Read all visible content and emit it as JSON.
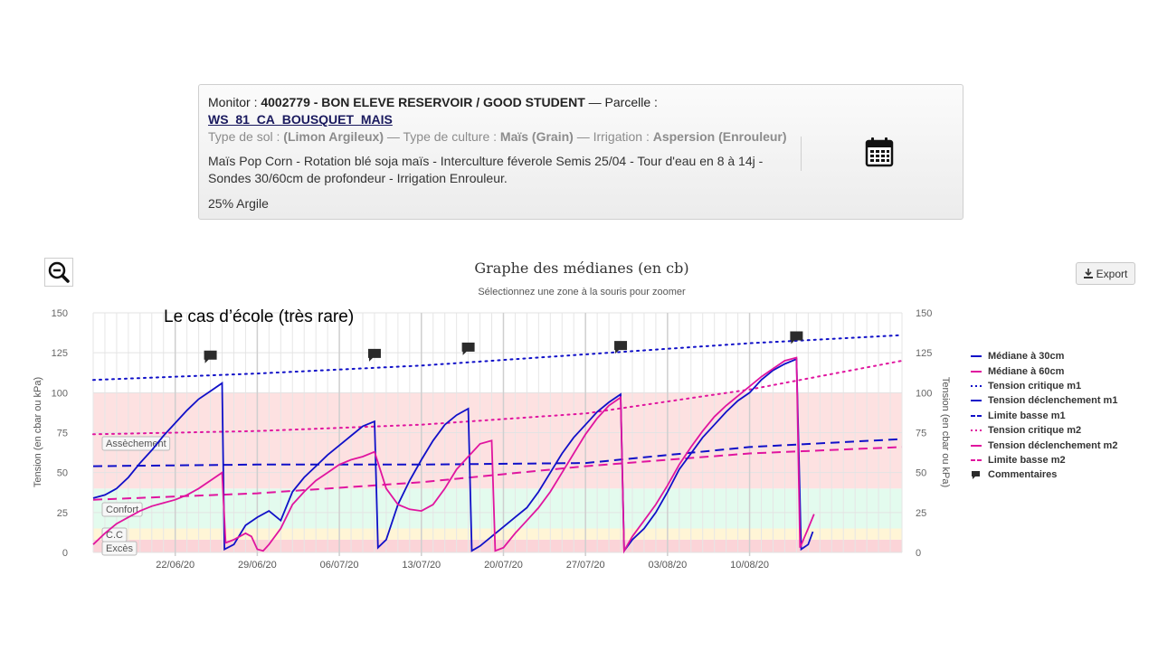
{
  "monitor": {
    "label": "Monitor :",
    "name": "4002779 - BON ELEVE RESERVOIR / GOOD STUDENT",
    "dash": "—",
    "parcelle_label": "Parcelle :",
    "parcelle": "WS_81_CA_BOUSQUET_MAIS",
    "soil_label": "Type de sol :",
    "soil": "(Limon Argileux)",
    "culture_label": "— Type de culture :",
    "culture": "Maïs (Grain)",
    "irrigation_label": "— Irrigation :",
    "irrigation": "Aspersion (Enrouleur)",
    "description": "Maïs Pop Corn - Rotation blé soja maïs - Interculture féverole Semis 25/04 - Tour d'eau en 8 à 14j - Sondes 30/60cm de profondeur - Irrigation Enrouleur.",
    "clay": "25% Argile"
  },
  "toolbar": {
    "export_label": "Export",
    "zoom_icon": "zoom-out-icon",
    "calendar_icon": "calendar-icon",
    "export_icon": "download-icon"
  },
  "annotation": "Le cas d’école (très rare)",
  "colors": {
    "m1": "#1010c8",
    "m2": "#e0159f",
    "assechement": "#fde1e1",
    "confort": "#e3fbee",
    "cc": "#fff5d6",
    "exces": "#fbd4d8"
  },
  "chart_data": {
    "type": "line",
    "title": "Graphe des médianes (en cb)",
    "subtitle": "Sélectionnez une zone à la souris pour zoomer",
    "ylabel": "Tension (en cbar ou kPa)",
    "ylabel_right": "Tension (en cbar ou kPa)",
    "ylim": [
      0,
      150
    ],
    "yticks": [
      0,
      25,
      50,
      75,
      100,
      125,
      150
    ],
    "xlim": [
      "2020-06-15",
      "2020-08-23"
    ],
    "xticks": [
      "22/06/20",
      "29/06/20",
      "06/07/20",
      "13/07/20",
      "20/07/20",
      "27/07/20",
      "03/08/20",
      "10/08/20"
    ],
    "grid": true,
    "legend_position": "right",
    "bands": [
      {
        "name": "Excès",
        "from": 0,
        "to": 8
      },
      {
        "name": "C.C",
        "from": 8,
        "to": 15
      },
      {
        "name": "Confort",
        "from": 15,
        "to": 40
      },
      {
        "name": "Assèchement",
        "from": 40,
        "to": 100
      }
    ],
    "series": [
      {
        "name": "Médiane à 30cm",
        "style": "solid",
        "group": "m1",
        "points": [
          [
            "2020-06-15",
            34
          ],
          [
            "2020-06-16",
            36
          ],
          [
            "2020-06-17",
            40
          ],
          [
            "2020-06-18",
            47
          ],
          [
            "2020-06-19",
            56
          ],
          [
            "2020-06-20",
            64
          ],
          [
            "2020-06-21",
            73
          ],
          [
            "2020-06-22",
            81
          ],
          [
            "2020-06-23",
            89
          ],
          [
            "2020-06-24",
            96
          ],
          [
            "2020-06-25",
            101
          ],
          [
            "2020-06-26",
            106
          ],
          [
            "2020-06-26.2",
            2
          ],
          [
            "2020-06-27",
            5
          ],
          [
            "2020-06-28",
            17
          ],
          [
            "2020-06-29",
            22
          ],
          [
            "2020-06-30",
            26
          ],
          [
            "2020-07-01",
            20
          ],
          [
            "2020-07-02",
            38
          ],
          [
            "2020-07-03",
            47
          ],
          [
            "2020-07-04",
            54
          ],
          [
            "2020-07-05",
            61
          ],
          [
            "2020-07-06",
            67
          ],
          [
            "2020-07-07",
            73
          ],
          [
            "2020-07-08",
            79
          ],
          [
            "2020-07-09",
            82
          ],
          [
            "2020-07-09.3",
            3
          ],
          [
            "2020-07-10",
            8
          ],
          [
            "2020-07-11",
            30
          ],
          [
            "2020-07-12",
            45
          ],
          [
            "2020-07-13",
            58
          ],
          [
            "2020-07-14",
            70
          ],
          [
            "2020-07-15",
            80
          ],
          [
            "2020-07-16",
            86
          ],
          [
            "2020-07-17",
            90
          ],
          [
            "2020-07-17.3",
            1
          ],
          [
            "2020-07-18",
            4
          ],
          [
            "2020-07-19",
            10
          ],
          [
            "2020-07-20",
            16
          ],
          [
            "2020-07-21",
            22
          ],
          [
            "2020-07-22",
            28
          ],
          [
            "2020-07-23",
            38
          ],
          [
            "2020-07-24",
            50
          ],
          [
            "2020-07-25",
            62
          ],
          [
            "2020-07-26",
            72
          ],
          [
            "2020-07-27",
            80
          ],
          [
            "2020-07-28",
            88
          ],
          [
            "2020-07-29",
            94
          ],
          [
            "2020-07-30",
            99
          ],
          [
            "2020-07-30.3",
            1
          ],
          [
            "2020-07-31",
            8
          ],
          [
            "2020-08-01",
            15
          ],
          [
            "2020-08-02",
            25
          ],
          [
            "2020-08-03",
            38
          ],
          [
            "2020-08-04",
            52
          ],
          [
            "2020-08-05",
            62
          ],
          [
            "2020-08-06",
            72
          ],
          [
            "2020-08-07",
            80
          ],
          [
            "2020-08-08",
            88
          ],
          [
            "2020-08-09",
            95
          ],
          [
            "2020-08-10",
            100
          ],
          [
            "2020-08-11",
            108
          ],
          [
            "2020-08-12",
            114
          ],
          [
            "2020-08-13",
            118
          ],
          [
            "2020-08-14",
            121
          ],
          [
            "2020-08-14.4",
            2
          ],
          [
            "2020-08-15",
            5
          ],
          [
            "2020-08-15.4",
            13
          ]
        ]
      },
      {
        "name": "Médiane à 60cm",
        "style": "solid",
        "group": "m2",
        "points": [
          [
            "2020-06-15",
            5
          ],
          [
            "2020-06-16",
            12
          ],
          [
            "2020-06-17",
            18
          ],
          [
            "2020-06-18",
            22
          ],
          [
            "2020-06-19",
            26
          ],
          [
            "2020-06-20",
            29
          ],
          [
            "2020-06-21",
            31
          ],
          [
            "2020-06-22",
            33
          ],
          [
            "2020-06-23",
            36
          ],
          [
            "2020-06-24",
            40
          ],
          [
            "2020-06-25",
            45
          ],
          [
            "2020-06-26",
            50
          ],
          [
            "2020-06-26.3",
            6
          ],
          [
            "2020-06-27",
            8
          ],
          [
            "2020-06-28",
            12
          ],
          [
            "2020-06-28.5",
            10
          ],
          [
            "2020-06-29",
            2
          ],
          [
            "2020-06-29.5",
            1
          ],
          [
            "2020-06-30",
            5
          ],
          [
            "2020-07-01",
            15
          ],
          [
            "2020-07-02",
            30
          ],
          [
            "2020-07-03",
            38
          ],
          [
            "2020-07-04",
            45
          ],
          [
            "2020-07-05",
            50
          ],
          [
            "2020-07-06",
            55
          ],
          [
            "2020-07-07",
            58
          ],
          [
            "2020-07-08",
            60
          ],
          [
            "2020-07-09",
            63
          ],
          [
            "2020-07-10",
            40
          ],
          [
            "2020-07-11",
            30
          ],
          [
            "2020-07-12",
            27
          ],
          [
            "2020-07-13",
            26
          ],
          [
            "2020-07-14",
            30
          ],
          [
            "2020-07-15",
            40
          ],
          [
            "2020-07-16",
            52
          ],
          [
            "2020-07-17",
            60
          ],
          [
            "2020-07-18",
            68
          ],
          [
            "2020-07-19",
            70
          ],
          [
            "2020-07-19.3",
            1
          ],
          [
            "2020-07-20",
            3
          ],
          [
            "2020-07-21",
            12
          ],
          [
            "2020-07-22",
            20
          ],
          [
            "2020-07-23",
            28
          ],
          [
            "2020-07-24",
            38
          ],
          [
            "2020-07-25",
            50
          ],
          [
            "2020-07-26",
            62
          ],
          [
            "2020-07-27",
            74
          ],
          [
            "2020-07-28",
            84
          ],
          [
            "2020-07-29",
            92
          ],
          [
            "2020-07-30",
            97
          ],
          [
            "2020-07-30.3",
            1
          ],
          [
            "2020-07-31",
            10
          ],
          [
            "2020-08-01",
            20
          ],
          [
            "2020-08-02",
            30
          ],
          [
            "2020-08-03",
            42
          ],
          [
            "2020-08-04",
            55
          ],
          [
            "2020-08-05",
            66
          ],
          [
            "2020-08-06",
            76
          ],
          [
            "2020-08-07",
            85
          ],
          [
            "2020-08-08",
            92
          ],
          [
            "2020-08-09",
            98
          ],
          [
            "2020-08-10",
            104
          ],
          [
            "2020-08-11",
            110
          ],
          [
            "2020-08-12",
            115
          ],
          [
            "2020-08-13",
            120
          ],
          [
            "2020-08-14",
            122
          ],
          [
            "2020-08-14.3",
            3
          ],
          [
            "2020-08-15",
            15
          ],
          [
            "2020-08-15.5",
            24
          ]
        ]
      },
      {
        "name": "Tension critique m1",
        "style": "dotted",
        "group": "m1",
        "points": [
          [
            "2020-06-15",
            108
          ],
          [
            "2020-06-29",
            112
          ],
          [
            "2020-07-13",
            117
          ],
          [
            "2020-07-27",
            124
          ],
          [
            "2020-08-10",
            131
          ],
          [
            "2020-08-23",
            136
          ]
        ]
      },
      {
        "name": "Tension déclenchement m1",
        "style": "solid-thin",
        "group": "m1",
        "points": []
      },
      {
        "name": "Limite basse m1",
        "style": "dashed",
        "group": "m1",
        "points": [
          [
            "2020-06-15",
            54
          ],
          [
            "2020-06-29",
            55
          ],
          [
            "2020-07-13",
            55
          ],
          [
            "2020-07-27",
            56
          ],
          [
            "2020-08-10",
            66
          ],
          [
            "2020-08-23",
            71
          ]
        ]
      },
      {
        "name": "Tension critique m2",
        "style": "dotted",
        "group": "m2",
        "points": [
          [
            "2020-06-15",
            74
          ],
          [
            "2020-06-29",
            76
          ],
          [
            "2020-07-13",
            80
          ],
          [
            "2020-07-27",
            87
          ],
          [
            "2020-08-10",
            102
          ],
          [
            "2020-08-23",
            120
          ]
        ]
      },
      {
        "name": "Tension déclenchement m2",
        "style": "solid-thin",
        "group": "m2",
        "points": []
      },
      {
        "name": "Limite basse m2",
        "style": "dashed",
        "group": "m2",
        "points": [
          [
            "2020-06-15",
            33
          ],
          [
            "2020-06-29",
            37
          ],
          [
            "2020-07-13",
            44
          ],
          [
            "2020-07-27",
            54
          ],
          [
            "2020-08-10",
            62
          ],
          [
            "2020-08-23",
            66
          ]
        ]
      },
      {
        "name": "Commentaires",
        "style": "marker",
        "group": "comments",
        "points": [
          [
            "2020-06-25",
            123
          ],
          [
            "2020-07-09",
            124
          ],
          [
            "2020-07-17",
            128
          ],
          [
            "2020-07-30",
            129
          ],
          [
            "2020-08-14",
            135
          ]
        ]
      }
    ]
  }
}
